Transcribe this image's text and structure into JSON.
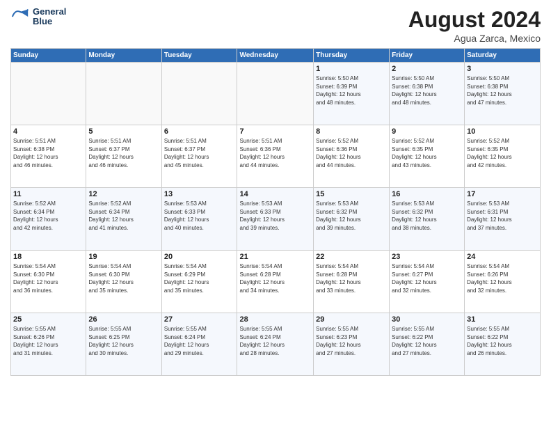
{
  "header": {
    "logo_line1": "General",
    "logo_line2": "Blue",
    "title": "August 2024",
    "subtitle": "Agua Zarca, Mexico"
  },
  "weekdays": [
    "Sunday",
    "Monday",
    "Tuesday",
    "Wednesday",
    "Thursday",
    "Friday",
    "Saturday"
  ],
  "weeks": [
    [
      {
        "day": "",
        "info": ""
      },
      {
        "day": "",
        "info": ""
      },
      {
        "day": "",
        "info": ""
      },
      {
        "day": "",
        "info": ""
      },
      {
        "day": "1",
        "info": "Sunrise: 5:50 AM\nSunset: 6:39 PM\nDaylight: 12 hours\nand 48 minutes."
      },
      {
        "day": "2",
        "info": "Sunrise: 5:50 AM\nSunset: 6:38 PM\nDaylight: 12 hours\nand 48 minutes."
      },
      {
        "day": "3",
        "info": "Sunrise: 5:50 AM\nSunset: 6:38 PM\nDaylight: 12 hours\nand 47 minutes."
      }
    ],
    [
      {
        "day": "4",
        "info": "Sunrise: 5:51 AM\nSunset: 6:38 PM\nDaylight: 12 hours\nand 46 minutes."
      },
      {
        "day": "5",
        "info": "Sunrise: 5:51 AM\nSunset: 6:37 PM\nDaylight: 12 hours\nand 46 minutes."
      },
      {
        "day": "6",
        "info": "Sunrise: 5:51 AM\nSunset: 6:37 PM\nDaylight: 12 hours\nand 45 minutes."
      },
      {
        "day": "7",
        "info": "Sunrise: 5:51 AM\nSunset: 6:36 PM\nDaylight: 12 hours\nand 44 minutes."
      },
      {
        "day": "8",
        "info": "Sunrise: 5:52 AM\nSunset: 6:36 PM\nDaylight: 12 hours\nand 44 minutes."
      },
      {
        "day": "9",
        "info": "Sunrise: 5:52 AM\nSunset: 6:35 PM\nDaylight: 12 hours\nand 43 minutes."
      },
      {
        "day": "10",
        "info": "Sunrise: 5:52 AM\nSunset: 6:35 PM\nDaylight: 12 hours\nand 42 minutes."
      }
    ],
    [
      {
        "day": "11",
        "info": "Sunrise: 5:52 AM\nSunset: 6:34 PM\nDaylight: 12 hours\nand 42 minutes."
      },
      {
        "day": "12",
        "info": "Sunrise: 5:52 AM\nSunset: 6:34 PM\nDaylight: 12 hours\nand 41 minutes."
      },
      {
        "day": "13",
        "info": "Sunrise: 5:53 AM\nSunset: 6:33 PM\nDaylight: 12 hours\nand 40 minutes."
      },
      {
        "day": "14",
        "info": "Sunrise: 5:53 AM\nSunset: 6:33 PM\nDaylight: 12 hours\nand 39 minutes."
      },
      {
        "day": "15",
        "info": "Sunrise: 5:53 AM\nSunset: 6:32 PM\nDaylight: 12 hours\nand 39 minutes."
      },
      {
        "day": "16",
        "info": "Sunrise: 5:53 AM\nSunset: 6:32 PM\nDaylight: 12 hours\nand 38 minutes."
      },
      {
        "day": "17",
        "info": "Sunrise: 5:53 AM\nSunset: 6:31 PM\nDaylight: 12 hours\nand 37 minutes."
      }
    ],
    [
      {
        "day": "18",
        "info": "Sunrise: 5:54 AM\nSunset: 6:30 PM\nDaylight: 12 hours\nand 36 minutes."
      },
      {
        "day": "19",
        "info": "Sunrise: 5:54 AM\nSunset: 6:30 PM\nDaylight: 12 hours\nand 35 minutes."
      },
      {
        "day": "20",
        "info": "Sunrise: 5:54 AM\nSunset: 6:29 PM\nDaylight: 12 hours\nand 35 minutes."
      },
      {
        "day": "21",
        "info": "Sunrise: 5:54 AM\nSunset: 6:28 PM\nDaylight: 12 hours\nand 34 minutes."
      },
      {
        "day": "22",
        "info": "Sunrise: 5:54 AM\nSunset: 6:28 PM\nDaylight: 12 hours\nand 33 minutes."
      },
      {
        "day": "23",
        "info": "Sunrise: 5:54 AM\nSunset: 6:27 PM\nDaylight: 12 hours\nand 32 minutes."
      },
      {
        "day": "24",
        "info": "Sunrise: 5:54 AM\nSunset: 6:26 PM\nDaylight: 12 hours\nand 32 minutes."
      }
    ],
    [
      {
        "day": "25",
        "info": "Sunrise: 5:55 AM\nSunset: 6:26 PM\nDaylight: 12 hours\nand 31 minutes."
      },
      {
        "day": "26",
        "info": "Sunrise: 5:55 AM\nSunset: 6:25 PM\nDaylight: 12 hours\nand 30 minutes."
      },
      {
        "day": "27",
        "info": "Sunrise: 5:55 AM\nSunset: 6:24 PM\nDaylight: 12 hours\nand 29 minutes."
      },
      {
        "day": "28",
        "info": "Sunrise: 5:55 AM\nSunset: 6:24 PM\nDaylight: 12 hours\nand 28 minutes."
      },
      {
        "day": "29",
        "info": "Sunrise: 5:55 AM\nSunset: 6:23 PM\nDaylight: 12 hours\nand 27 minutes."
      },
      {
        "day": "30",
        "info": "Sunrise: 5:55 AM\nSunset: 6:22 PM\nDaylight: 12 hours\nand 27 minutes."
      },
      {
        "day": "31",
        "info": "Sunrise: 5:55 AM\nSunset: 6:22 PM\nDaylight: 12 hours\nand 26 minutes."
      }
    ]
  ]
}
